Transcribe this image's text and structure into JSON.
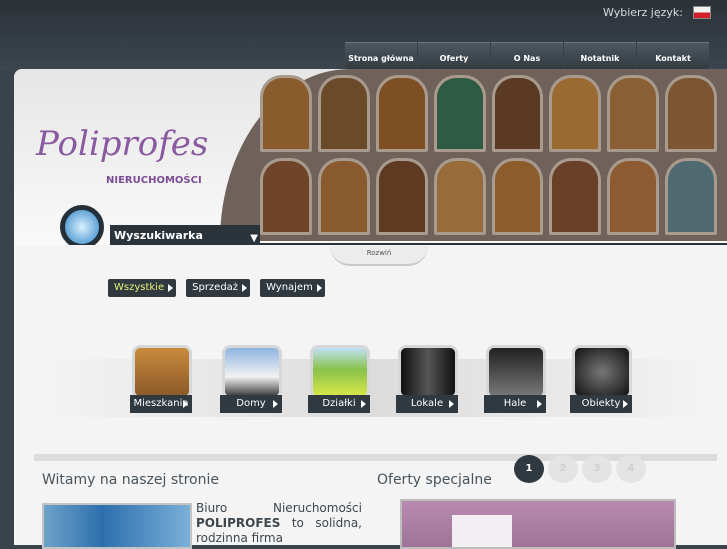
{
  "language": {
    "label": "Wybierz język:",
    "flag_icon": "poland-flag-icon"
  },
  "nav": [
    "Strona główna",
    "Oferty",
    "O Nas",
    "Notatnik",
    "Kontakt"
  ],
  "logo": {
    "name": "Poliprofes",
    "subtitle": "NIERUCHOMOŚCI"
  },
  "search": {
    "label": "Wyszukiwarka"
  },
  "expand_label": "Rozwiń",
  "filters": [
    "Wszystkie",
    "Sprzedaż",
    "Wynajem"
  ],
  "categories": [
    "Mieszkania",
    "Domy",
    "Działki",
    "Lokale",
    "Hale",
    "Obiekty"
  ],
  "pagination": [
    "1",
    "2",
    "3",
    "4"
  ],
  "welcome": {
    "title": "Witamy na naszej stronie",
    "text_pre": "Biuro Nieruchomości ",
    "text_bold": "POLIPROFES",
    "text_post": " to solidna, rodzinna firma"
  },
  "offers": {
    "title": "Oferty specjalne"
  },
  "colors": {
    "accent": "#2f393f",
    "logo": "#8a5aa0",
    "active_filter": "#e7f27a"
  }
}
